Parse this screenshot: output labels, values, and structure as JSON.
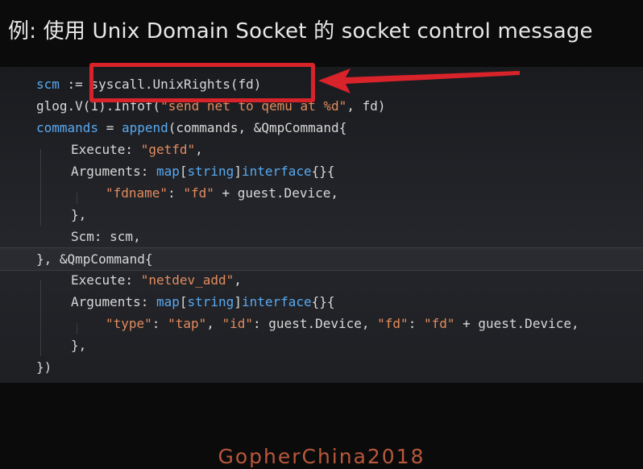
{
  "slide": {
    "title": "例: 使用 Unix Domain Socket 的 socket control message",
    "footer": "GopherChina2018"
  },
  "code": {
    "lines": [
      "scm := syscall.UnixRights(fd)",
      "glog.V(1).Infof(\"send net to qemu at %d\", fd)",
      "commands = append(commands, &QmpCommand{",
      "    Execute: \"getfd\",",
      "    Arguments: map[string]interface{}{",
      "        \"fdname\": \"fd\" + guest.Device,",
      "    },",
      "    Scm: scm,",
      "}, &QmpCommand{",
      "    Execute: \"netdev_add\",",
      "    Arguments: map[string]interface{}{",
      "        \"type\": \"tap\", \"id\": guest.Device, \"fd\": \"fd\" + guest.Device,",
      "    },",
      "})"
    ],
    "highlighted": "syscall.UnixRights(fd)"
  },
  "colors": {
    "highlight_box": "#d9232a",
    "keyword": "#59a9f0",
    "string": "#e28c5e",
    "footer": "#b8573a"
  }
}
